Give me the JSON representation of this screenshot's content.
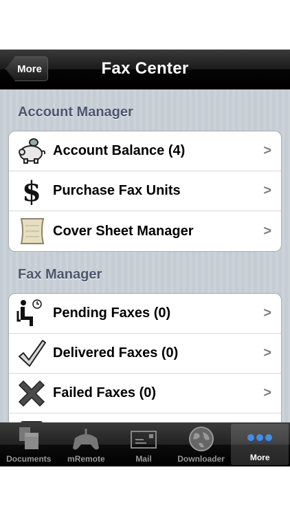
{
  "navbar": {
    "back_label": "More",
    "title": "Fax Center"
  },
  "sections": {
    "account": {
      "header": "Account Manager",
      "items": [
        {
          "label": "Account Balance (4)",
          "icon": "piggy-bank-icon"
        },
        {
          "label": "Purchase Fax Units",
          "icon": "dollar-icon"
        },
        {
          "label": "Cover Sheet Manager",
          "icon": "scroll-icon"
        }
      ]
    },
    "fax": {
      "header": "Fax Manager",
      "items": [
        {
          "label": "Pending Faxes (0)",
          "icon": "waiting-person-icon"
        },
        {
          "label": "Delivered Faxes (0)",
          "icon": "checkmark-icon"
        },
        {
          "label": "Failed Faxes (0)",
          "icon": "x-mark-icon"
        }
      ]
    }
  },
  "chevron": ">",
  "tabbar": {
    "tabs": [
      {
        "label": "Documents",
        "icon": "documents-icon"
      },
      {
        "label": "mRemote",
        "icon": "gamepad-icon"
      },
      {
        "label": "Mail",
        "icon": "mail-icon"
      },
      {
        "label": "Downloader",
        "icon": "globe-icon"
      },
      {
        "label": "More",
        "icon": "more-dots-icon",
        "active": true
      }
    ]
  },
  "colors": {
    "section_header": "#4c566c",
    "active_dots": "#3d8ef0"
  }
}
